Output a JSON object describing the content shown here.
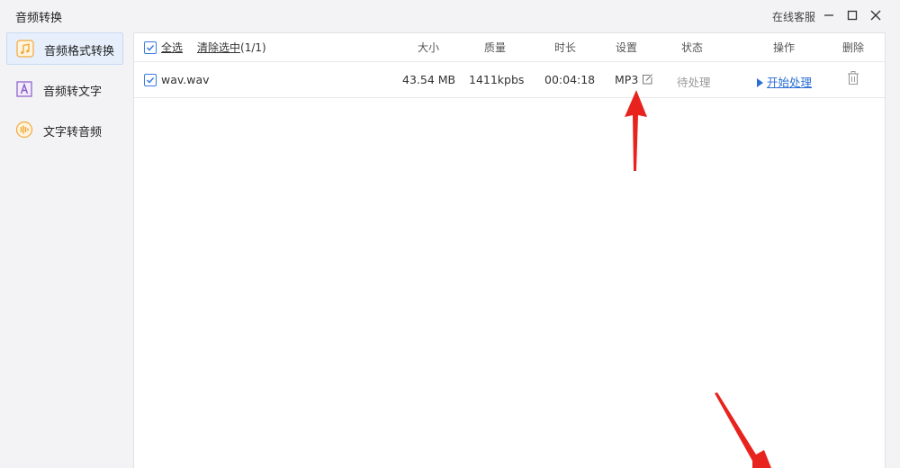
{
  "window": {
    "title": "音频转换",
    "online_service": "在线客服",
    "min_icon": "minimize-icon",
    "max_icon": "maximize-icon",
    "close_icon": "close-icon"
  },
  "sidebar": {
    "items": [
      {
        "label": "音频格式转换",
        "icon": "music-note-icon",
        "active": true
      },
      {
        "label": "音频转文字",
        "icon": "text-a-icon",
        "active": false
      },
      {
        "label": "文字转音频",
        "icon": "sound-wave-icon",
        "active": false
      }
    ]
  },
  "table": {
    "select_all": "全选",
    "clear_selected": "清除选中",
    "selection_count": "(1/1)",
    "columns": {
      "size": "大小",
      "quality": "质量",
      "duration": "时长",
      "settings": "设置",
      "status": "状态",
      "action": "操作",
      "delete": "删除"
    },
    "rows": [
      {
        "filename": "wav.wav",
        "size": "43.54 MB",
        "quality": "1411kpbs",
        "duration": "00:04:18",
        "format": "MP3",
        "status": "待处理",
        "action": "开始处理"
      }
    ]
  },
  "colors": {
    "accent": "#2b6fd6",
    "annotation_arrow": "#e8231e",
    "sidebar_active_bg": "#e6effb"
  }
}
